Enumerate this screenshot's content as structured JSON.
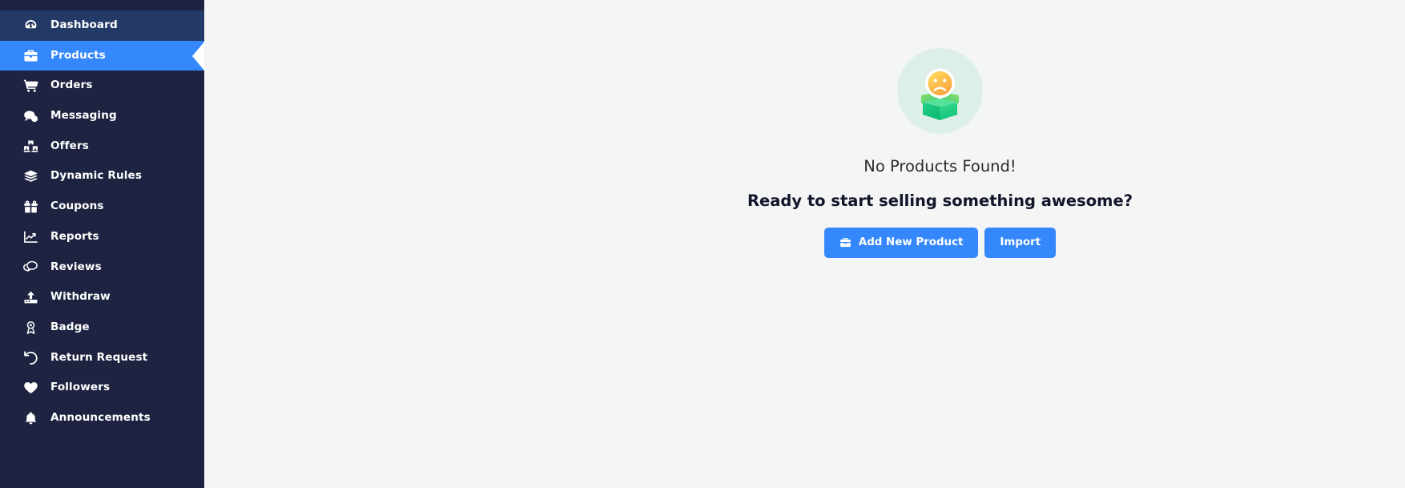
{
  "theme": {
    "sidebar_bg": "#1d2340",
    "sidebar_first_item_bg": "#233a66",
    "active_blue": "#3588fb",
    "page_bg": "#f4f5f5",
    "illustration_circle": "#dcf0e8",
    "box_green": "#22cc88",
    "face_yellow": "#ffc53d",
    "title_color": "#2b2b2b"
  },
  "sidebar": {
    "items": [
      {
        "label": "Dashboard",
        "icon": "dashboard-gauge-icon",
        "active": false
      },
      {
        "label": "Products",
        "icon": "briefcase-icon",
        "active": true
      },
      {
        "label": "Orders",
        "icon": "shopping-cart-icon",
        "active": false
      },
      {
        "label": "Messaging",
        "icon": "chat-bubble-icon",
        "active": false
      },
      {
        "label": "Offers",
        "icon": "boxes-stack-icon",
        "active": false
      },
      {
        "label": "Dynamic Rules",
        "icon": "layers-icon",
        "active": false
      },
      {
        "label": "Coupons",
        "icon": "gift-icon",
        "active": false
      },
      {
        "label": "Reports",
        "icon": "chart-line-icon",
        "active": false
      },
      {
        "label": "Reviews",
        "icon": "comments-icon",
        "active": false
      },
      {
        "label": "Withdraw",
        "icon": "upload-icon",
        "active": false
      },
      {
        "label": "Badge",
        "icon": "award-medal-icon",
        "active": false
      },
      {
        "label": "Return Request",
        "icon": "undo-arrow-icon",
        "active": false
      },
      {
        "label": "Followers",
        "icon": "heart-icon",
        "active": false
      },
      {
        "label": "Announcements",
        "icon": "bell-icon",
        "active": false
      }
    ]
  },
  "main": {
    "empty_state": {
      "illustration": "sad-face-open-box-illustration",
      "title": "No Products Found!",
      "subtitle": "Ready to start selling something awesome?",
      "primary_button": {
        "label": "Add New Product",
        "icon": "briefcase-icon"
      },
      "secondary_button": {
        "label": "Import"
      }
    }
  }
}
